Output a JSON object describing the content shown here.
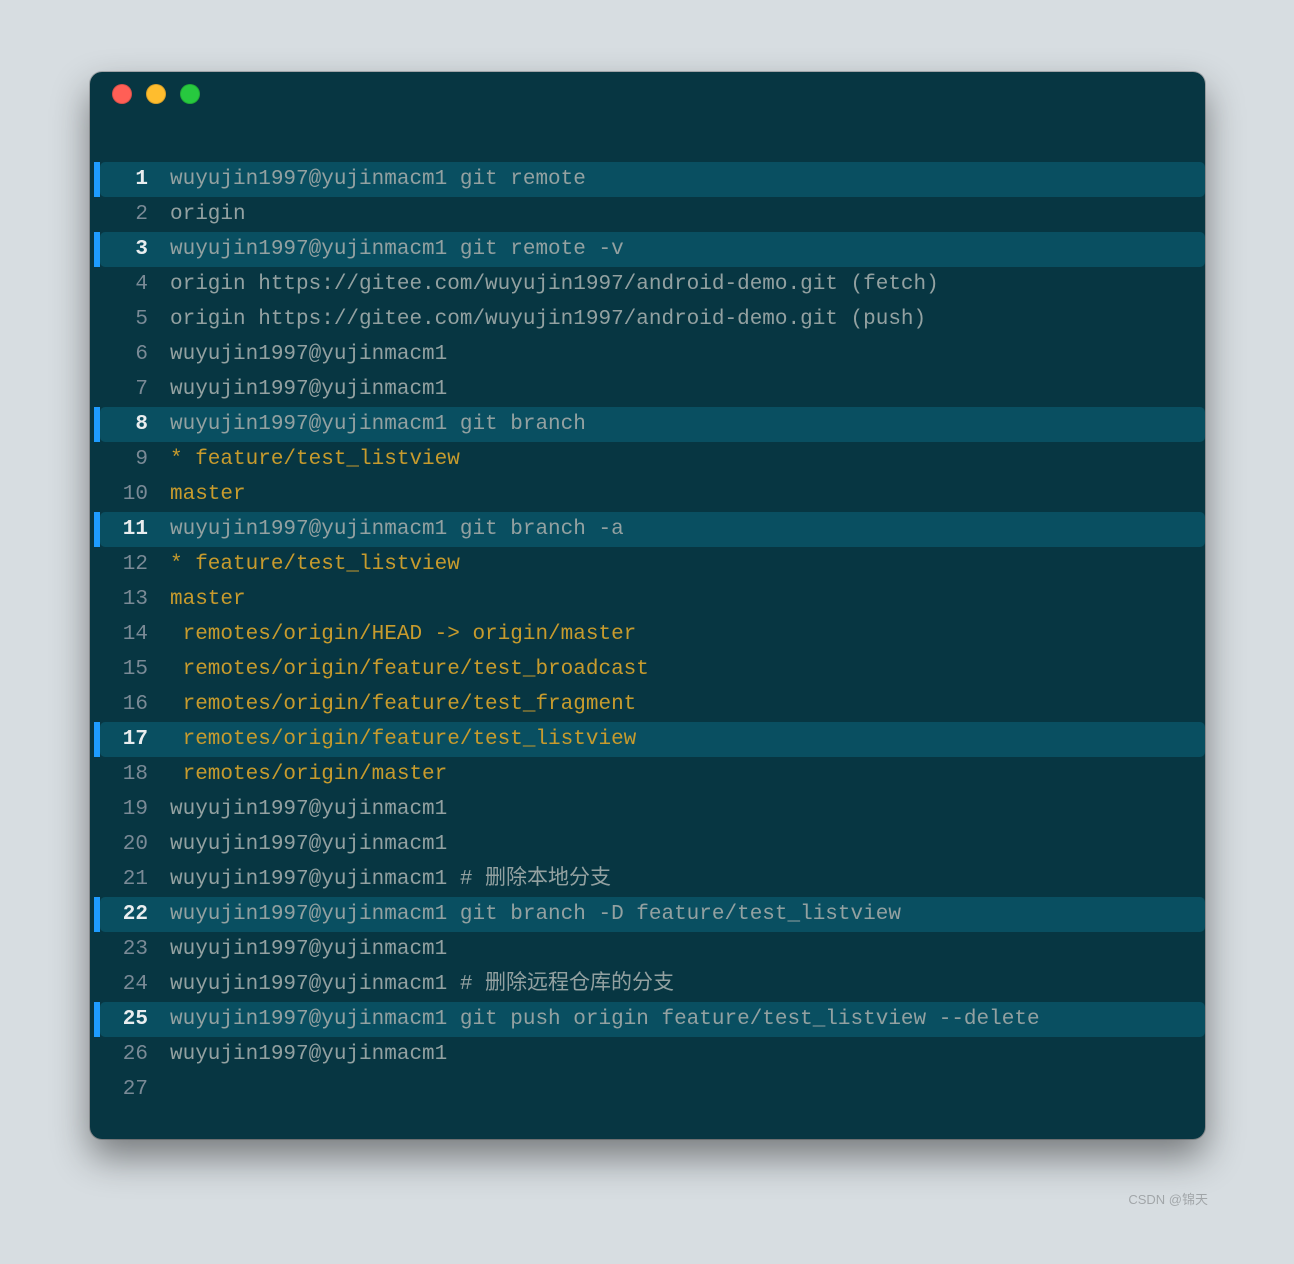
{
  "watermark": "CSDN @锦天",
  "colors": {
    "bg_page": "#d7dde1",
    "bg_term": "#073642",
    "hl": "#094f61",
    "mark": "#1e9cff",
    "gray": "#93a1a1",
    "gold": "#c79b2d"
  },
  "lines": [
    {
      "num": "1",
      "hl": true,
      "mark": true,
      "color": "gray",
      "text": "wuyujin1997@yujinmacm1 git remote"
    },
    {
      "num": "2",
      "hl": false,
      "mark": false,
      "color": "gray",
      "text": "origin"
    },
    {
      "num": "3",
      "hl": true,
      "mark": true,
      "color": "gray",
      "text": "wuyujin1997@yujinmacm1 git remote -v"
    },
    {
      "num": "4",
      "hl": false,
      "mark": false,
      "color": "gray",
      "text": "origin https://gitee.com/wuyujin1997/android-demo.git (fetch)"
    },
    {
      "num": "5",
      "hl": false,
      "mark": false,
      "color": "gray",
      "text": "origin https://gitee.com/wuyujin1997/android-demo.git (push)"
    },
    {
      "num": "6",
      "hl": false,
      "mark": false,
      "color": "gray",
      "text": "wuyujin1997@yujinmacm1"
    },
    {
      "num": "7",
      "hl": false,
      "mark": false,
      "color": "gray",
      "text": "wuyujin1997@yujinmacm1"
    },
    {
      "num": "8",
      "hl": true,
      "mark": true,
      "color": "gray",
      "text": "wuyujin1997@yujinmacm1 git branch"
    },
    {
      "num": "9",
      "hl": false,
      "mark": false,
      "color": "gold",
      "text": "* feature/test_listview"
    },
    {
      "num": "10",
      "hl": false,
      "mark": false,
      "color": "gold",
      "text": "master"
    },
    {
      "num": "11",
      "hl": true,
      "mark": true,
      "color": "gray",
      "text": "wuyujin1997@yujinmacm1 git branch -a"
    },
    {
      "num": "12",
      "hl": false,
      "mark": false,
      "color": "gold",
      "text": "* feature/test_listview"
    },
    {
      "num": "13",
      "hl": false,
      "mark": false,
      "color": "gold",
      "text": "master"
    },
    {
      "num": "14",
      "hl": false,
      "mark": false,
      "color": "gold",
      "text": " remotes/origin/HEAD -> origin/master"
    },
    {
      "num": "15",
      "hl": false,
      "mark": false,
      "color": "gold",
      "text": " remotes/origin/feature/test_broadcast"
    },
    {
      "num": "16",
      "hl": false,
      "mark": false,
      "color": "gold",
      "text": " remotes/origin/feature/test_fragment"
    },
    {
      "num": "17",
      "hl": true,
      "mark": true,
      "color": "gold",
      "text": " remotes/origin/feature/test_listview"
    },
    {
      "num": "18",
      "hl": false,
      "mark": false,
      "color": "gold",
      "text": " remotes/origin/master"
    },
    {
      "num": "19",
      "hl": false,
      "mark": false,
      "color": "gray",
      "text": "wuyujin1997@yujinmacm1"
    },
    {
      "num": "20",
      "hl": false,
      "mark": false,
      "color": "gray",
      "text": "wuyujin1997@yujinmacm1"
    },
    {
      "num": "21",
      "hl": false,
      "mark": false,
      "color": "gray",
      "text": "wuyujin1997@yujinmacm1 # 删除本地分支"
    },
    {
      "num": "22",
      "hl": true,
      "mark": true,
      "color": "gray",
      "text": "wuyujin1997@yujinmacm1 git branch -D feature/test_listview"
    },
    {
      "num": "23",
      "hl": false,
      "mark": false,
      "color": "gray",
      "text": "wuyujin1997@yujinmacm1"
    },
    {
      "num": "24",
      "hl": false,
      "mark": false,
      "color": "gray",
      "text": "wuyujin1997@yujinmacm1 # 删除远程仓库的分支"
    },
    {
      "num": "25",
      "hl": true,
      "mark": true,
      "color": "gray",
      "text": "wuyujin1997@yujinmacm1 git push origin feature/test_listview --delete"
    },
    {
      "num": "26",
      "hl": false,
      "mark": false,
      "color": "gray",
      "text": "wuyujin1997@yujinmacm1"
    },
    {
      "num": "27",
      "hl": false,
      "mark": false,
      "color": "gray",
      "text": ""
    }
  ]
}
